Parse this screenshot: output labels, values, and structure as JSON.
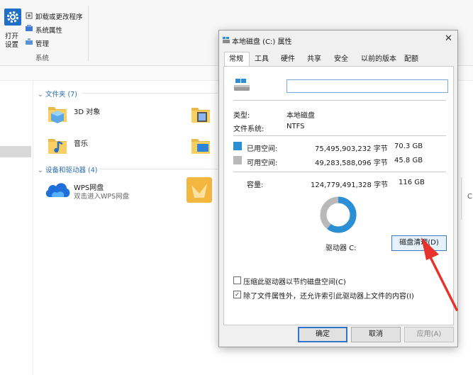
{
  "ribbon": {
    "open_settings_line1": "打开",
    "open_settings_line2": "设置",
    "uninstall": "卸载或更改程序",
    "system_props": "系统属性",
    "manage": "管理",
    "group_label": "系统"
  },
  "explorer": {
    "folders_header": "文件夹 (7)",
    "folders": [
      {
        "label": "3D 对象"
      },
      {
        "label": "音乐"
      }
    ],
    "devices_header": "设备和驱动器 (4)",
    "devices": [
      {
        "label": "WPS网盘",
        "sub": "双击进入WPS网盘"
      }
    ],
    "cut_edge": "C"
  },
  "dialog": {
    "title": "本地磁盘 (C:) 属性",
    "close": "✕",
    "tabs": [
      "常规",
      "工具",
      "硬件",
      "共享",
      "安全",
      "以前的版本",
      "配额"
    ],
    "active_tab": "常规",
    "name_value": "",
    "type_label": "类型:",
    "type_value": "本地磁盘",
    "fs_label": "文件系统:",
    "fs_value": "NTFS",
    "used_label": "已用空间:",
    "used_bytes": "75,495,903,232 字节",
    "used_gb": "70.3 GB",
    "free_label": "可用空间:",
    "free_bytes": "49,283,588,096 字节",
    "free_gb": "45.8 GB",
    "capacity_label": "容量:",
    "capacity_bytes": "124,779,491,328 字节",
    "capacity_gb": "116 GB",
    "drive_label": "驱动器 C:",
    "cleanup_button": "磁盘清理(D)",
    "compress_label": "压缩此驱动器以节约磁盘空间(C)",
    "index_label": "除了文件属性外，还允许索引此驱动器上文件的内容(I)",
    "ok": "确定",
    "cancel": "取消",
    "apply": "应用(A)",
    "colors": {
      "used": "#2a8fd4",
      "free": "#b9b9b9"
    },
    "used_fraction": 0.605
  }
}
